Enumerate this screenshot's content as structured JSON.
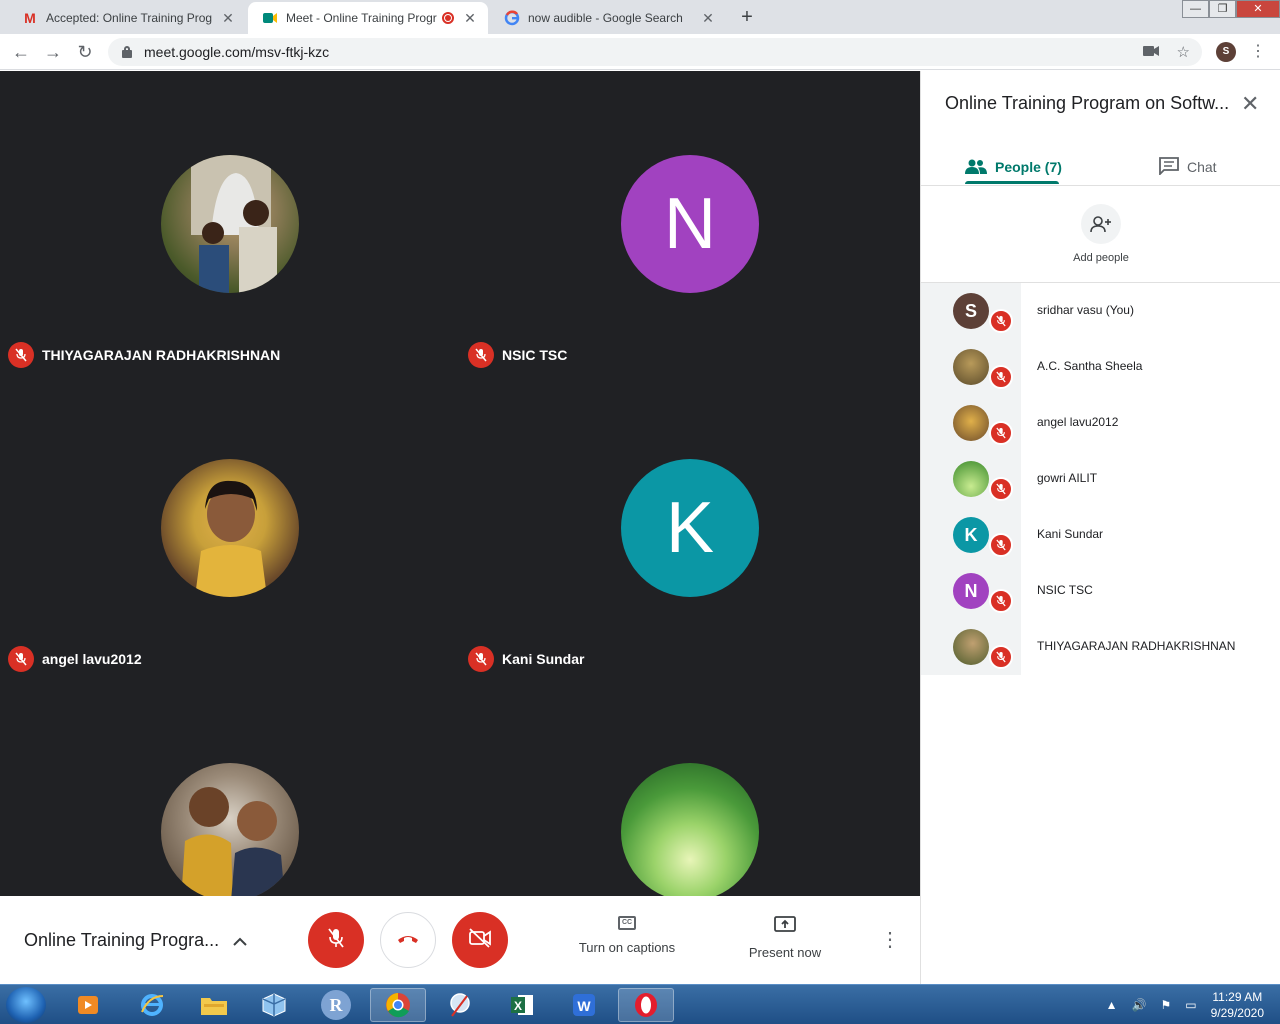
{
  "browser": {
    "tabs": [
      {
        "title": "Accepted: Online Training Progra",
        "icon": "gmail-icon"
      },
      {
        "title": "Meet - Online Training Progr",
        "icon": "meet-icon"
      },
      {
        "title": "now audible - Google Search",
        "icon": "google-icon"
      }
    ],
    "url": "meet.google.com/msv-ftkj-kzc",
    "profile_initial": "S"
  },
  "tiles": [
    {
      "name": "THIYAGARAJAN RADHAKRISHNAN",
      "letter": "",
      "color": "#6b7a4a"
    },
    {
      "name": "NSIC TSC",
      "letter": "N",
      "color": "#a142c0"
    },
    {
      "name": "angel lavu2012",
      "letter": "",
      "color": "#c8a03a"
    },
    {
      "name": "Kani Sundar",
      "letter": "K",
      "color": "#0b97a5"
    },
    {
      "name": "",
      "letter": "",
      "color": "#6d5a3d"
    },
    {
      "name": "",
      "letter": "",
      "color": "#5aa33c"
    }
  ],
  "bottom": {
    "meeting_title": "Online Training Progra...",
    "captions_label": "Turn on captions",
    "captions_icon": "CC",
    "present_label": "Present now"
  },
  "panel": {
    "title": "Online Training Program on Softw...",
    "people_tab": "People (7)",
    "chat_tab": "Chat",
    "add_people": "Add people",
    "participants": [
      {
        "name": "sridhar vasu (You)",
        "letter": "S",
        "color": "#5d4037"
      },
      {
        "name": "A.C. Santha Sheela",
        "letter": "",
        "color": "#7a6a3a"
      },
      {
        "name": "angel lavu2012",
        "letter": "",
        "color": "#c8a03a"
      },
      {
        "name": "gowri AILIT",
        "letter": "",
        "color": "#5aa33c"
      },
      {
        "name": "Kani Sundar",
        "letter": "K",
        "color": "#0b97a5"
      },
      {
        "name": "NSIC TSC",
        "letter": "N",
        "color": "#a142c0"
      },
      {
        "name": "THIYAGARAJAN RADHAKRISHNAN",
        "letter": "",
        "color": "#6b7a4a"
      }
    ]
  },
  "taskbar": {
    "time": "11:29 AM",
    "date": "9/29/2020"
  },
  "colors": {
    "meet_red": "#d93025",
    "meet_teal": "#00796b",
    "stage_bg": "#202124"
  }
}
